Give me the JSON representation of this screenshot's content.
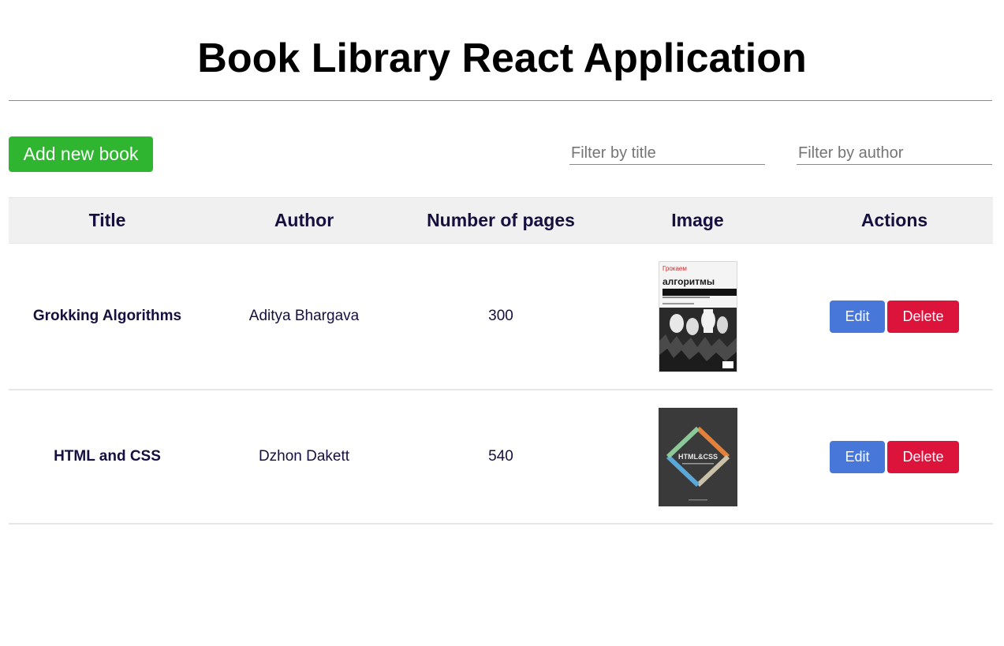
{
  "header": {
    "title": "Book Library React Application"
  },
  "toolbar": {
    "add_label": "Add new book",
    "filter_title_placeholder": "Filter by title",
    "filter_author_placeholder": "Filter by author"
  },
  "table": {
    "columns": [
      "Title",
      "Author",
      "Number of pages",
      "Image",
      "Actions"
    ],
    "rows": [
      {
        "title": "Grokking Algorithms",
        "author": "Aditya Bhargava",
        "pages": "300",
        "cover_icon": "grokking-algorithms-cover-icon",
        "cover_text": {
          "top": "Грокаем",
          "main": "алгоритмы"
        }
      },
      {
        "title": "HTML and CSS",
        "author": "Dzhon Dakett",
        "pages": "540",
        "cover_icon": "html-css-cover-icon",
        "cover_text": {
          "main": "HTML&CSS"
        }
      }
    ],
    "edit_label": "Edit",
    "delete_label": "Delete"
  },
  "colors": {
    "add_button": "#2fb530",
    "edit_button": "#4677d9",
    "delete_button": "#dc143c",
    "header_bg": "#f0f0f0",
    "text_dark": "#15103e"
  }
}
